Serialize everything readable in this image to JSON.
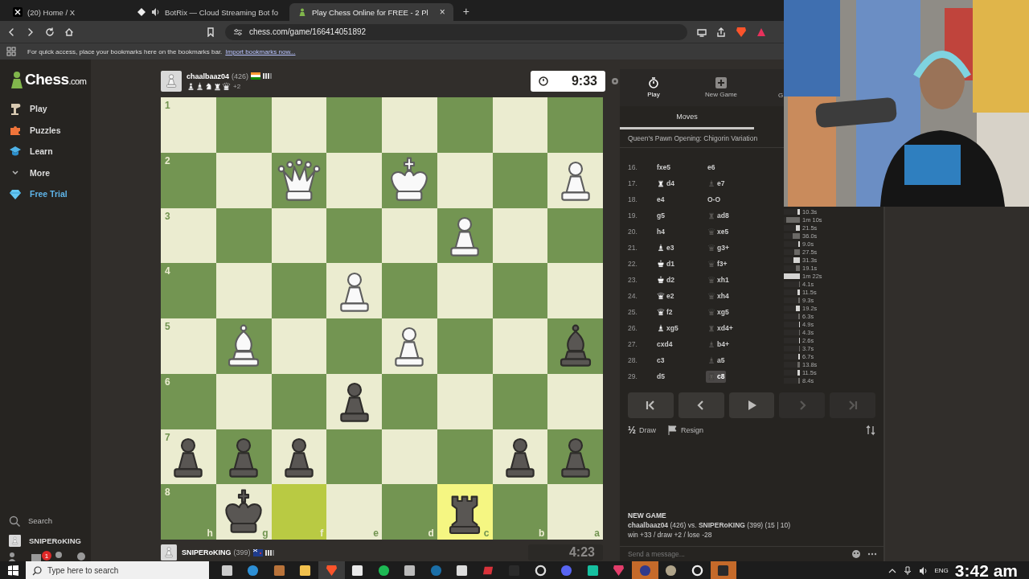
{
  "browser": {
    "tabs": [
      {
        "title": "(20) Home / X",
        "kind": "x",
        "audio": false,
        "selected": false
      },
      {
        "title": "BotRix — Cloud Streaming Bot fo",
        "kind": "bot",
        "audio": true,
        "selected": false
      },
      {
        "title": "Play Chess Online for FREE - 2 Pl",
        "kind": "pawn",
        "audio": false,
        "selected": true
      }
    ],
    "close_tab": "×",
    "new_tab": "+",
    "url": "chess.com/game/166414051892",
    "bookmarks_hint": "For quick access, place your bookmarks here on the bookmarks bar.",
    "bookmarks_link": "Import bookmarks now..."
  },
  "sidebar": {
    "logo": {
      "word": "Chess",
      "suffix": ".com"
    },
    "items": [
      {
        "label": "Play",
        "kind": "play"
      },
      {
        "label": "Puzzles",
        "kind": "puzzles"
      },
      {
        "label": "Learn",
        "kind": "learn"
      },
      {
        "label": "More",
        "kind": "more"
      },
      {
        "label": "Free Trial",
        "kind": "trial"
      }
    ],
    "search": "Search",
    "user": "SNIPERoKING",
    "notifications": "1"
  },
  "game": {
    "top_player": {
      "name": "chaalbaaz04",
      "rating": "(426)",
      "captured": [
        {
          "kind": "pawn"
        },
        {
          "kind": "bishop"
        },
        {
          "kind": "knight"
        },
        {
          "kind": "rook"
        },
        {
          "kind": "queen"
        }
      ],
      "advantage": "+2",
      "clock": "9:33",
      "clock_active": true
    },
    "board": {
      "files": [
        "h",
        "g",
        "f",
        "e",
        "d",
        "c",
        "b",
        "a"
      ],
      "ranks": [
        {
          "label": "1",
          "squares": [
            {
              "kind": "empty",
              "highlighted": false
            },
            {
              "kind": "empty",
              "highlighted": false
            },
            {
              "kind": "empty",
              "highlighted": false
            },
            {
              "kind": "empty",
              "highlighted": false
            },
            {
              "kind": "empty",
              "highlighted": false
            },
            {
              "kind": "empty",
              "highlighted": false
            },
            {
              "kind": "empty",
              "highlighted": false
            },
            {
              "kind": "empty",
              "highlighted": false
            }
          ]
        },
        {
          "label": "2",
          "squares": [
            {
              "kind": "empty",
              "highlighted": false
            },
            {
              "kind": "empty",
              "highlighted": false
            },
            {
              "kind": "white-queen",
              "highlighted": false
            },
            {
              "kind": "empty",
              "highlighted": false
            },
            {
              "kind": "white-king",
              "highlighted": false
            },
            {
              "kind": "empty",
              "highlighted": false
            },
            {
              "kind": "empty",
              "highlighted": false
            },
            {
              "kind": "white-pawn",
              "highlighted": false
            }
          ]
        },
        {
          "label": "3",
          "squares": [
            {
              "kind": "empty",
              "highlighted": false
            },
            {
              "kind": "empty",
              "highlighted": false
            },
            {
              "kind": "empty",
              "highlighted": false
            },
            {
              "kind": "empty",
              "highlighted": false
            },
            {
              "kind": "empty",
              "highlighted": false
            },
            {
              "kind": "white-pawn",
              "highlighted": false
            },
            {
              "kind": "empty",
              "highlighted": false
            },
            {
              "kind": "empty",
              "highlighted": false
            }
          ]
        },
        {
          "label": "4",
          "squares": [
            {
              "kind": "empty",
              "highlighted": false
            },
            {
              "kind": "empty",
              "highlighted": false
            },
            {
              "kind": "empty",
              "highlighted": false
            },
            {
              "kind": "white-pawn",
              "highlighted": false
            },
            {
              "kind": "empty",
              "highlighted": false
            },
            {
              "kind": "empty",
              "highlighted": false
            },
            {
              "kind": "empty",
              "highlighted": false
            },
            {
              "kind": "empty",
              "highlighted": false
            }
          ]
        },
        {
          "label": "5",
          "squares": [
            {
              "kind": "empty",
              "highlighted": false
            },
            {
              "kind": "white-bishop",
              "highlighted": false
            },
            {
              "kind": "empty",
              "highlighted": false
            },
            {
              "kind": "empty",
              "highlighted": false
            },
            {
              "kind": "white-pawn",
              "highlighted": false
            },
            {
              "kind": "empty",
              "highlighted": false
            },
            {
              "kind": "empty",
              "highlighted": false
            },
            {
              "kind": "black-bishop",
              "highlighted": false
            }
          ]
        },
        {
          "label": "6",
          "squares": [
            {
              "kind": "empty",
              "highlighted": false
            },
            {
              "kind": "empty",
              "highlighted": false
            },
            {
              "kind": "empty",
              "highlighted": false
            },
            {
              "kind": "black-pawn",
              "highlighted": false
            },
            {
              "kind": "empty",
              "highlighted": false
            },
            {
              "kind": "empty",
              "highlighted": false
            },
            {
              "kind": "empty",
              "highlighted": false
            },
            {
              "kind": "empty",
              "highlighted": false
            }
          ]
        },
        {
          "label": "7",
          "squares": [
            {
              "kind": "black-pawn",
              "highlighted": false
            },
            {
              "kind": "black-pawn",
              "highlighted": false
            },
            {
              "kind": "black-pawn",
              "highlighted": false
            },
            {
              "kind": "empty",
              "highlighted": false
            },
            {
              "kind": "empty",
              "highlighted": false
            },
            {
              "kind": "empty",
              "highlighted": false
            },
            {
              "kind": "black-pawn",
              "highlighted": false
            },
            {
              "kind": "black-pawn",
              "highlighted": false
            }
          ]
        },
        {
          "label": "8",
          "squares": [
            {
              "kind": "empty",
              "highlighted": false
            },
            {
              "kind": "black-king",
              "highlighted": false
            },
            {
              "kind": "empty",
              "highlighted": true
            },
            {
              "kind": "empty",
              "highlighted": false
            },
            {
              "kind": "empty",
              "highlighted": false
            },
            {
              "kind": "black-rook",
              "highlighted": true
            },
            {
              "kind": "empty",
              "highlighted": false
            },
            {
              "kind": "empty",
              "highlighted": false
            }
          ]
        }
      ]
    },
    "bottom_player": {
      "name": "SNIPERoKING",
      "rating": "(399)",
      "clock": "4:23",
      "clock_active": false
    }
  },
  "panel": {
    "tabs": [
      {
        "label": "Play",
        "kind": "stopwatch",
        "selected": true
      },
      {
        "label": "New Game",
        "kind": "plus",
        "selected": false
      },
      {
        "label": "G",
        "kind": "cut",
        "selected": false
      }
    ],
    "moves_tab": "Moves",
    "opening": "Queen's Pawn Opening: Chigorin Variation",
    "moves": [
      {
        "number": "16.",
        "white": {
          "san": "fxe5",
          "selected": false
        },
        "black": {
          "san": "e6",
          "selected": false
        }
      },
      {
        "number": "17.",
        "white": {
          "kind": "rook",
          "san": "d4",
          "selected": false
        },
        "black": {
          "kind": "bishop",
          "san": "e7",
          "selected": false
        }
      },
      {
        "number": "18.",
        "white": {
          "san": "e4",
          "selected": false
        },
        "black": {
          "san": "O-O",
          "selected": false
        }
      },
      {
        "number": "19.",
        "white": {
          "san": "g5",
          "selected": false
        },
        "black": {
          "kind": "rook",
          "san": "ad8",
          "selected": false
        },
        "times": [
          {
            "text": "10.3s",
            "level": 0.13
          },
          {
            "text": "1m 10s",
            "level": 0.85
          }
        ]
      },
      {
        "number": "20.",
        "white": {
          "san": "h4",
          "selected": false
        },
        "black": {
          "kind": "queen",
          "san": "xe5",
          "selected": false
        },
        "times": [
          {
            "text": "21.5s",
            "level": 0.26
          },
          {
            "text": "36.0s",
            "level": 0.44
          }
        ]
      },
      {
        "number": "21.",
        "white": {
          "kind": "bishop",
          "san": "e3",
          "selected": false
        },
        "black": {
          "kind": "queen",
          "san": "g3+",
          "selected": false
        },
        "times": [
          {
            "text": "9.0s",
            "level": 0.11
          },
          {
            "text": "27.5s",
            "level": 0.34
          }
        ]
      },
      {
        "number": "22.",
        "white": {
          "kind": "king",
          "san": "d1",
          "selected": false
        },
        "black": {
          "kind": "queen",
          "san": "f3+",
          "selected": false
        },
        "times": [
          {
            "text": "31.3s",
            "level": 0.38
          },
          {
            "text": "19.1s",
            "level": 0.23
          }
        ]
      },
      {
        "number": "23.",
        "white": {
          "kind": "king",
          "san": "d2",
          "selected": false
        },
        "black": {
          "kind": "queen",
          "san": "xh1",
          "selected": false
        },
        "times": [
          {
            "text": "1m 22s",
            "level": 1
          },
          {
            "text": "4.1s",
            "level": 0.05
          }
        ]
      },
      {
        "number": "24.",
        "white": {
          "kind": "queen",
          "san": "e2",
          "selected": false
        },
        "black": {
          "kind": "queen",
          "san": "xh4",
          "selected": false
        },
        "times": [
          {
            "text": "11.5s",
            "level": 0.14
          },
          {
            "text": "9.3s",
            "level": 0.11
          }
        ]
      },
      {
        "number": "25.",
        "white": {
          "kind": "queen",
          "san": "f2",
          "selected": false
        },
        "black": {
          "kind": "queen",
          "san": "xg5",
          "selected": false
        },
        "times": [
          {
            "text": "19.2s",
            "level": 0.23
          },
          {
            "text": "6.3s",
            "level": 0.08
          }
        ]
      },
      {
        "number": "26.",
        "white": {
          "kind": "bishop",
          "san": "xg5",
          "selected": false
        },
        "black": {
          "kind": "rook",
          "san": "xd4+",
          "selected": false
        },
        "times": [
          {
            "text": "4.9s",
            "level": 0.06
          },
          {
            "text": "4.3s",
            "level": 0.05
          }
        ]
      },
      {
        "number": "27.",
        "white": {
          "san": "cxd4",
          "selected": false
        },
        "black": {
          "kind": "bishop",
          "san": "b4+",
          "selected": false
        },
        "times": [
          {
            "text": "2.6s",
            "level": 0.03
          },
          {
            "text": "3.7s",
            "level": 0.05
          }
        ]
      },
      {
        "number": "28.",
        "white": {
          "san": "c3",
          "selected": false
        },
        "black": {
          "kind": "bishop",
          "san": "a5",
          "selected": false
        },
        "times": [
          {
            "text": "6.7s",
            "level": 0.08
          },
          {
            "text": "13.8s",
            "level": 0.17
          }
        ]
      },
      {
        "number": "29.",
        "white": {
          "san": "d5",
          "selected": false
        },
        "black": {
          "kind": "rook",
          "san": "c8",
          "selected": true
        },
        "times": [
          {
            "text": "11.5s",
            "level": 0.14
          },
          {
            "text": "8.4s",
            "level": 0.1
          }
        ]
      }
    ],
    "controls": [
      {
        "kind": "first",
        "disabled": false
      },
      {
        "kind": "previous",
        "disabled": false
      },
      {
        "kind": "play",
        "disabled": false
      },
      {
        "kind": "next",
        "disabled": true
      },
      {
        "kind": "last",
        "disabled": true
      }
    ],
    "actions": [
      {
        "kind": "symbol",
        "symbol": "½",
        "label": "Draw"
      },
      {
        "kind": "flag",
        "label": "Resign"
      }
    ],
    "chat": {
      "heading": "NEW GAME",
      "players_line": "**chaalbaaz04** (426) vs. **SNIPERoKING** (399) (15 | 10)",
      "score_line": "win +33 / draw +2 / lose -28",
      "placeholder": "Send a message..."
    }
  },
  "taskbar": {
    "search_placeholder": "Type here to search",
    "apps": [
      {
        "kind": "taskview",
        "selected": false
      },
      {
        "kind": "edge",
        "selected": false
      },
      {
        "kind": "game",
        "selected": false
      },
      {
        "kind": "folder",
        "selected": false
      },
      {
        "kind": "brave",
        "selected": true
      },
      {
        "kind": "store",
        "selected": false
      },
      {
        "kind": "spotify",
        "selected": false
      },
      {
        "kind": "mail",
        "selected": false
      },
      {
        "kind": "steam",
        "selected": false
      },
      {
        "kind": "app",
        "selected": false
      },
      {
        "kind": "tf",
        "selected": false
      },
      {
        "kind": "epic",
        "selected": false
      },
      {
        "kind": "obs",
        "selected": false
      },
      {
        "kind": "discord",
        "selected": false
      },
      {
        "kind": "waves",
        "selected": false
      },
      {
        "kind": "pin",
        "selected": false
      },
      {
        "kind": "keyboard",
        "selected": true
      },
      {
        "kind": "paint",
        "selected": false
      },
      {
        "kind": "settings",
        "selected": false
      },
      {
        "kind": "epic",
        "selected": true
      }
    ],
    "language": "ENG",
    "time": "3:42 am"
  }
}
